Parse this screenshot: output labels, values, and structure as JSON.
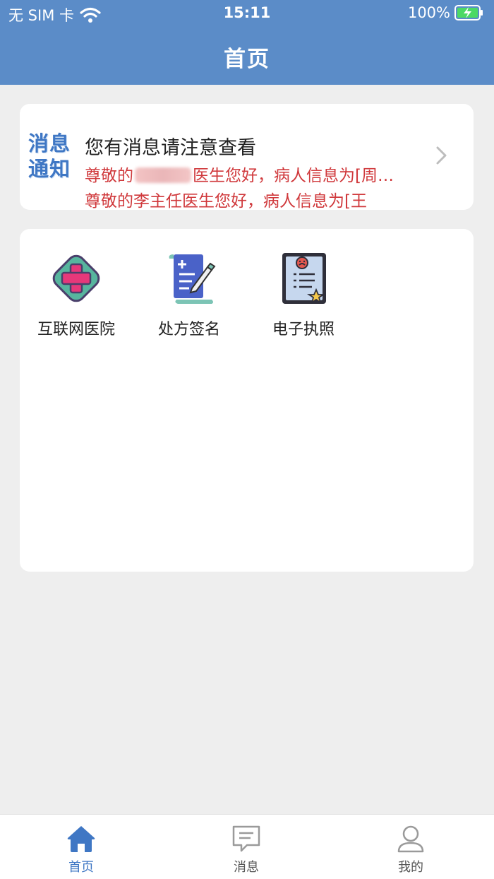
{
  "status_bar": {
    "carrier": "无 SIM 卡",
    "time": "15:11",
    "battery": "100%"
  },
  "header": {
    "title": "首页"
  },
  "notice": {
    "badge_line1": "消息",
    "badge_line2": "通知",
    "title": "您有消息请注意查看",
    "line1_before": "尊敬的",
    "line1_after": "医生您好，病人信息为[周…",
    "line2": "尊敬的李主任医生您好，病人信息为[王"
  },
  "apps": [
    {
      "label": "互联网医院",
      "icon": "hospital-cross-icon"
    },
    {
      "label": "处方签名",
      "icon": "prescription-sign-icon"
    },
    {
      "label": "电子执照",
      "icon": "electronic-license-icon"
    }
  ],
  "tabs": [
    {
      "label": "首页",
      "icon": "home-icon",
      "active": true
    },
    {
      "label": "消息",
      "icon": "message-icon",
      "active": false
    },
    {
      "label": "我的",
      "icon": "user-icon",
      "active": false
    }
  ],
  "colors": {
    "header_bg": "#5b8cc8",
    "accent": "#3f77c4",
    "notice_text": "#d0393c",
    "page_bg": "#eeeeee"
  }
}
